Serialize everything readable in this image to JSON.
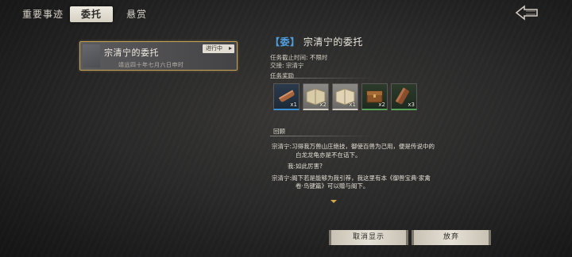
{
  "tabs": [
    {
      "label": "重要事迹"
    },
    {
      "label": "委托"
    },
    {
      "label": "悬赏"
    }
  ],
  "quest_list": [
    {
      "title": "宗清宁的委托",
      "date": "靖远四十年七月六日申时",
      "status": "进行中"
    }
  ],
  "detail": {
    "badge": "【委】",
    "title": "宗清宁的委托",
    "deadline": "任务截止时间: 不限时",
    "contact": "交接: 宗清宁",
    "rewards_label": "任务奖励",
    "rewards": [
      {
        "icon": "scroll-icon",
        "count": "x1",
        "rarity": "blue"
      },
      {
        "icon": "book-icon",
        "count": "x2",
        "rarity": "white"
      },
      {
        "icon": "book-icon",
        "count": "x1",
        "rarity": "white"
      },
      {
        "icon": "chest-icon",
        "count": "x2",
        "rarity": "green"
      },
      {
        "icon": "wood-icon",
        "count": "x3",
        "rarity": "green"
      }
    ],
    "review_label": "回顾",
    "dialog": [
      {
        "l1": "宗清宁:习得我万兽山庄绝技，御使百兽为己用，便是传说中的",
        "l2": "白龙龙龟亦是不在话下。"
      },
      {
        "l1": "我:如此厉害?"
      },
      {
        "l1": "宗清宁:阁下若是能够为我引荐，我这里有本《御兽宝典·家禽",
        "l2": "卷·鸟键篇》可以赠与阁下。"
      }
    ]
  },
  "buttons": {
    "cancel_label": "取消显示",
    "abandon_label": "放弃"
  },
  "colors": {
    "badge_blue": "#4f9ee0",
    "selected_border": "#c4a257",
    "rarity_blue": "#3d8fd4",
    "rarity_green": "#58a35a"
  }
}
